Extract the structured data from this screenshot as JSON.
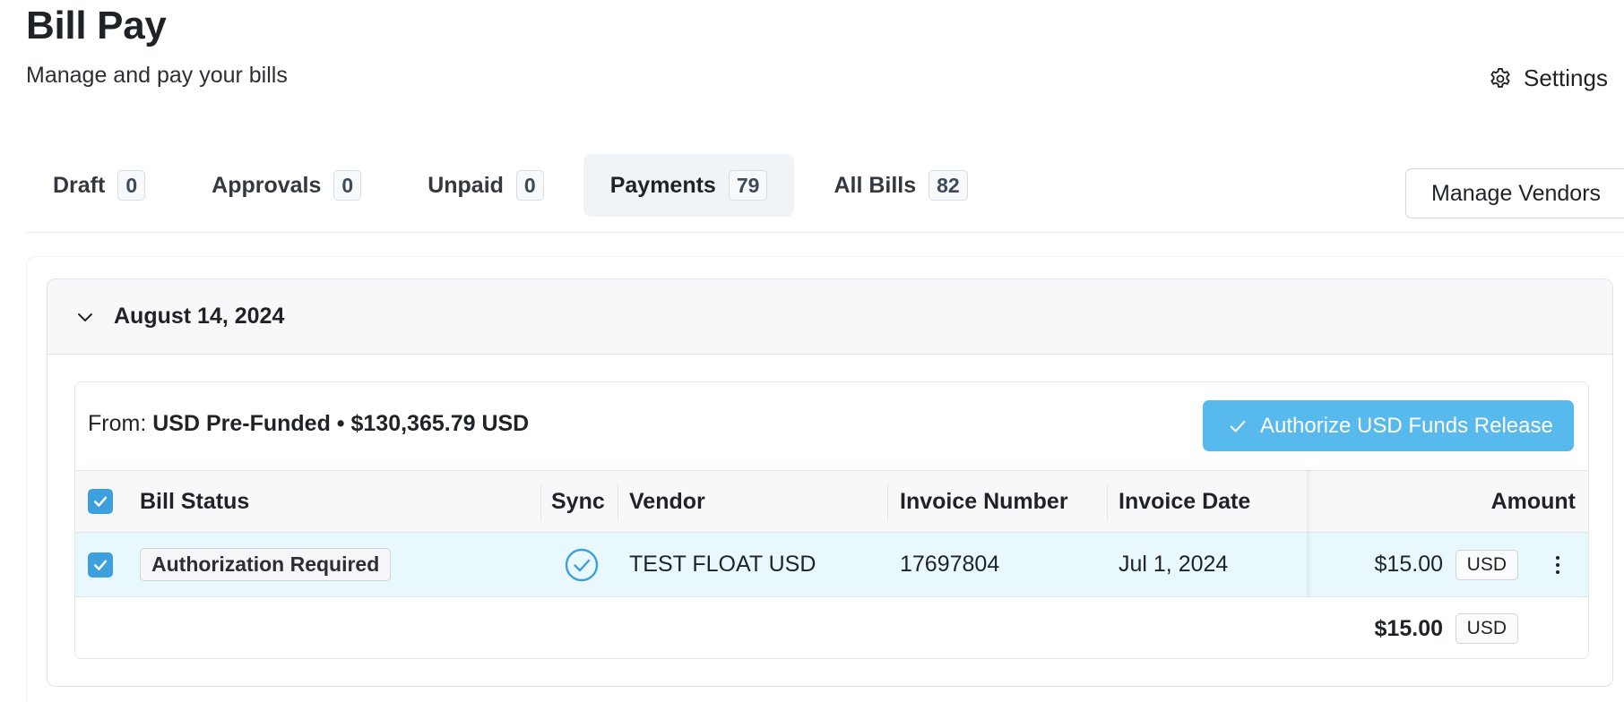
{
  "header": {
    "title": "Bill Pay",
    "subtitle": "Manage and pay your bills",
    "settings_label": "Settings"
  },
  "tabs": [
    {
      "label": "Draft",
      "count": "0",
      "active": false
    },
    {
      "label": "Approvals",
      "count": "0",
      "active": false
    },
    {
      "label": "Unpaid",
      "count": "0",
      "active": false
    },
    {
      "label": "Payments",
      "count": "79",
      "active": true
    },
    {
      "label": "All Bills",
      "count": "82",
      "active": false
    }
  ],
  "manage_vendors_label": "Manage Vendors",
  "group": {
    "date": "August 14, 2024",
    "from_prefix": "From: ",
    "from_value": "USD Pre-Funded • $130,365.79 USD",
    "authorize_label": "Authorize USD Funds Release",
    "columns": {
      "bill_status": "Bill Status",
      "sync": "Sync",
      "vendor": "Vendor",
      "invoice_number": "Invoice Number",
      "invoice_date": "Invoice Date",
      "amount": "Amount"
    },
    "rows": [
      {
        "selected": true,
        "bill_status": "Authorization Required",
        "synced": true,
        "vendor": "TEST FLOAT USD",
        "invoice_number": "17697804",
        "invoice_date": "Jul 1, 2024",
        "amount": "$15.00",
        "currency": "USD"
      }
    ],
    "total": {
      "amount": "$15.00",
      "currency": "USD"
    }
  },
  "colors": {
    "accent": "#57b9ec",
    "checkbox": "#3d9fdc",
    "selected_row": "#e8f8fd",
    "active_tab": "#f1f4f7"
  }
}
